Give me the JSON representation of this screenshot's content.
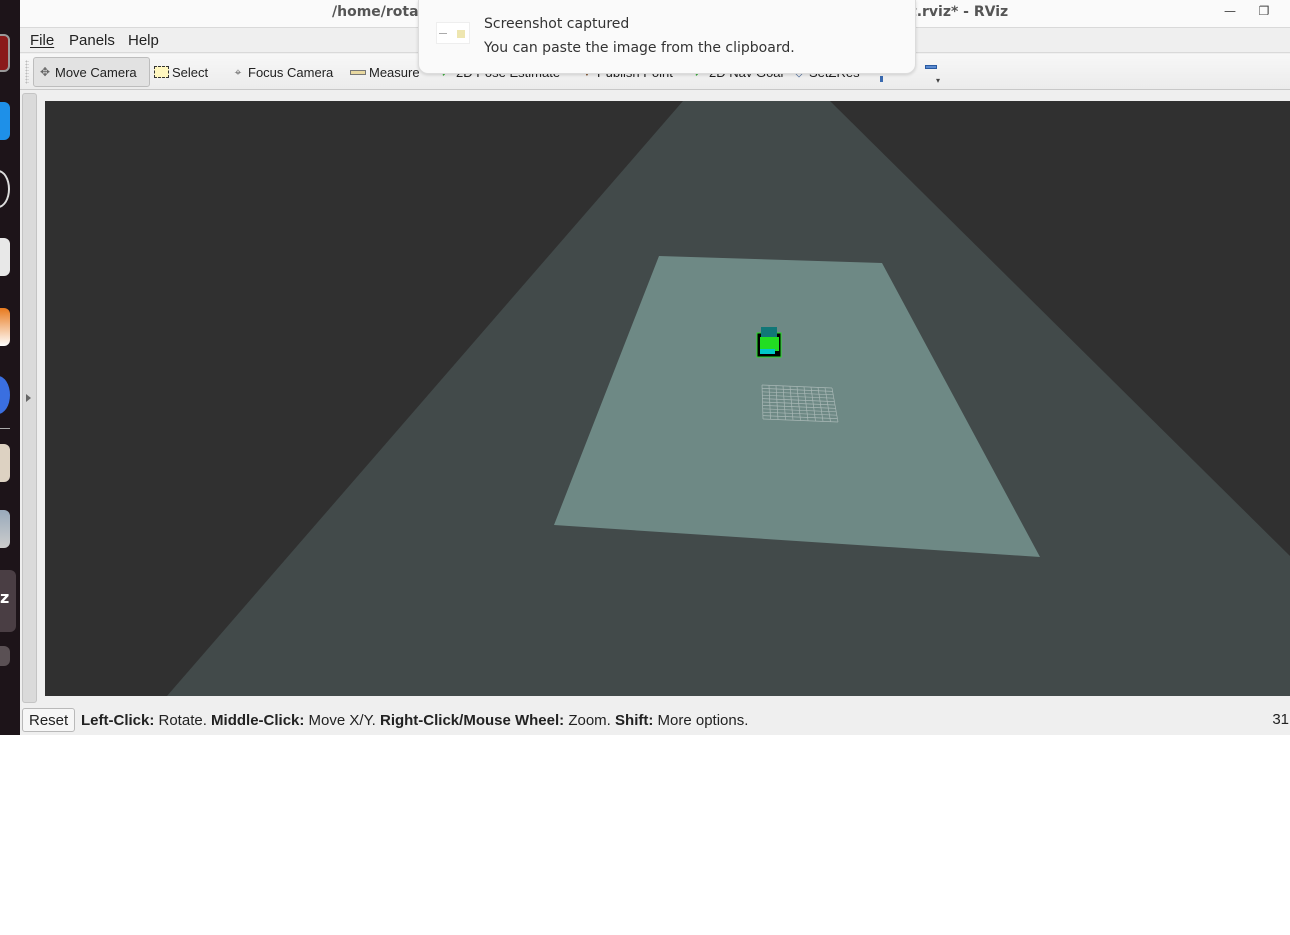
{
  "window": {
    "title_left": "/home/rota_",
    "title_right": "t.rviz* - RViz",
    "minimize_label": "—",
    "restore_label": "❐"
  },
  "menu": {
    "items": [
      {
        "label": "File"
      },
      {
        "label": "Panels"
      },
      {
        "label": "Help"
      }
    ]
  },
  "toolbar": {
    "tools": [
      {
        "label": "Move Camera",
        "icon": "move-camera-icon",
        "active": true
      },
      {
        "label": "Select",
        "icon": "select-icon",
        "active": false
      },
      {
        "label": "Focus Camera",
        "icon": "focus-camera-icon",
        "active": false
      },
      {
        "label": "Measure",
        "icon": "ruler-icon",
        "active": false
      },
      {
        "label": "2D Pose Estimate",
        "icon": "pose-arrow-icon",
        "active": false
      },
      {
        "label": "Publish Point",
        "icon": "pin-icon",
        "active": false
      },
      {
        "label": "2D Nav Goal",
        "icon": "goal-arrow-icon",
        "active": false
      },
      {
        "label": "SetZRes",
        "icon": "diamond-icon",
        "active": false
      }
    ],
    "overflow_label": "▾"
  },
  "notification": {
    "title": "Screenshot captured",
    "body": "You can paste the image from the clipboard."
  },
  "viewport": {
    "background_color": "#303030",
    "plane_color": "#424a4a",
    "map_color": "#6e8985",
    "robot_colors": [
      "#00c8c8",
      "#22dd22",
      "#117777"
    ],
    "grid_color": "#a9b8b6"
  },
  "statusbar": {
    "reset_label": "Reset",
    "hint": [
      {
        "bold": "Left-Click:",
        "text": " Rotate. "
      },
      {
        "bold": "Middle-Click:",
        "text": " Move X/Y. "
      },
      {
        "bold": "Right-Click/Mouse Wheel:",
        "text": " Zoom. "
      },
      {
        "bold": "Shift:",
        "text": " More options."
      }
    ],
    "fps": "31"
  }
}
